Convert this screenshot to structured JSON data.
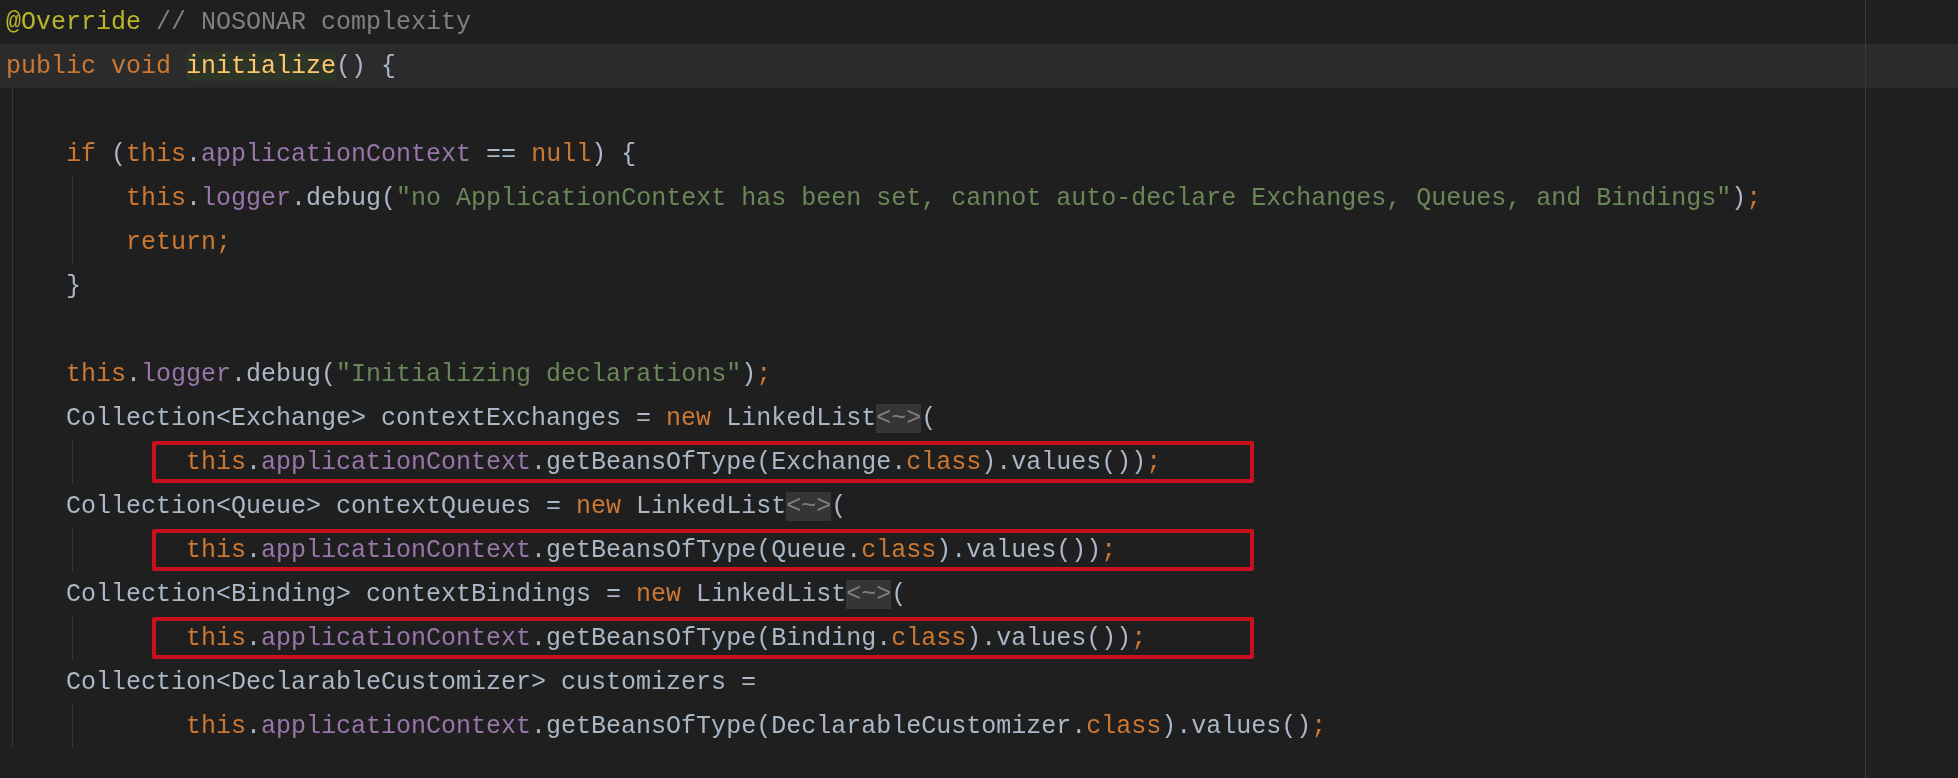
{
  "lines": [
    {
      "kind": "code",
      "current": false,
      "tokens": [
        {
          "kind": "annotation",
          "text": "@Override"
        },
        {
          "kind": "comment",
          "text": " // NOSONAR complexity"
        }
      ]
    },
    {
      "kind": "code",
      "current": true,
      "tokens": [
        {
          "kind": "keyword",
          "text": "public void "
        },
        {
          "kind": "declaration",
          "text": "initialize"
        },
        {
          "kind": "plain",
          "text": "() {"
        }
      ],
      "children": [
        {
          "kind": "blank",
          "current": false
        },
        {
          "kind": "code",
          "current": false,
          "tokens": [
            {
              "kind": "keyword",
              "text": "if"
            },
            {
              "kind": "plain",
              "text": " ("
            },
            {
              "kind": "keyword",
              "text": "this"
            },
            {
              "kind": "plain",
              "text": "."
            },
            {
              "kind": "field",
              "text": "applicationContext"
            },
            {
              "kind": "plain",
              "text": " == "
            },
            {
              "kind": "keyword",
              "text": "null"
            },
            {
              "kind": "plain",
              "text": ") {"
            }
          ],
          "children": [
            {
              "kind": "code",
              "current": false,
              "tokens": [
                {
                  "kind": "keyword",
                  "text": "this"
                },
                {
                  "kind": "plain",
                  "text": "."
                },
                {
                  "kind": "field",
                  "text": "logger"
                },
                {
                  "kind": "plain",
                  "text": ".debug("
                },
                {
                  "kind": "string",
                  "text": "\"no ApplicationContext has been set, cannot auto-declare Exchanges, Queues, and Bindings\""
                },
                {
                  "kind": "plain",
                  "text": ")"
                },
                {
                  "kind": "keyword",
                  "text": ";"
                }
              ]
            },
            {
              "kind": "code",
              "current": false,
              "tokens": [
                {
                  "kind": "keyword",
                  "text": "return;"
                }
              ]
            }
          ]
        },
        {
          "kind": "code",
          "current": false,
          "tokens": [
            {
              "kind": "plain",
              "text": "}"
            }
          ]
        },
        {
          "kind": "blank",
          "current": false
        },
        {
          "kind": "code",
          "current": false,
          "tokens": [
            {
              "kind": "keyword",
              "text": "this"
            },
            {
              "kind": "plain",
              "text": "."
            },
            {
              "kind": "field",
              "text": "logger"
            },
            {
              "kind": "plain",
              "text": ".debug("
            },
            {
              "kind": "string",
              "text": "\"Initializing declarations\""
            },
            {
              "kind": "plain",
              "text": ")"
            },
            {
              "kind": "keyword",
              "text": ";"
            }
          ]
        },
        {
          "kind": "code",
          "current": false,
          "tokens": [
            {
              "kind": "plain",
              "text": "Collection<Exchange> contextExchanges = "
            },
            {
              "kind": "keyword",
              "text": "new"
            },
            {
              "kind": "plain",
              "text": " LinkedList"
            },
            {
              "kind": "folded",
              "text": "<~>"
            },
            {
              "kind": "plain",
              "text": "("
            }
          ],
          "children": [
            {
              "kind": "continuation",
              "current": false,
              "boxed": true,
              "tokens": [
                {
                  "kind": "keyword",
                  "text": "this"
                },
                {
                  "kind": "plain",
                  "text": "."
                },
                {
                  "kind": "field",
                  "text": "applicationContext"
                },
                {
                  "kind": "plain",
                  "text": ".getBeansOfType(Exchange."
                },
                {
                  "kind": "keyword",
                  "text": "class"
                },
                {
                  "kind": "plain",
                  "text": ").values())"
                },
                {
                  "kind": "keyword",
                  "text": ";"
                }
              ]
            }
          ]
        },
        {
          "kind": "code",
          "current": false,
          "tokens": [
            {
              "kind": "plain",
              "text": "Collection<Queue> contextQueues = "
            },
            {
              "kind": "keyword",
              "text": "new"
            },
            {
              "kind": "plain",
              "text": " LinkedList"
            },
            {
              "kind": "folded",
              "text": "<~>"
            },
            {
              "kind": "plain",
              "text": "("
            }
          ],
          "children": [
            {
              "kind": "continuation",
              "current": false,
              "boxed": true,
              "tokens": [
                {
                  "kind": "keyword",
                  "text": "this"
                },
                {
                  "kind": "plain",
                  "text": "."
                },
                {
                  "kind": "field",
                  "text": "applicationContext"
                },
                {
                  "kind": "plain",
                  "text": ".getBeansOfType(Queue."
                },
                {
                  "kind": "keyword",
                  "text": "class"
                },
                {
                  "kind": "plain",
                  "text": ").values())"
                },
                {
                  "kind": "keyword",
                  "text": ";"
                }
              ]
            }
          ]
        },
        {
          "kind": "code",
          "current": false,
          "tokens": [
            {
              "kind": "plain",
              "text": "Collection<Binding> contextBindings = "
            },
            {
              "kind": "keyword",
              "text": "new"
            },
            {
              "kind": "plain",
              "text": " LinkedList"
            },
            {
              "kind": "folded",
              "text": "<~>"
            },
            {
              "kind": "plain",
              "text": "("
            }
          ],
          "children": [
            {
              "kind": "continuation",
              "current": false,
              "boxed": true,
              "tokens": [
                {
                  "kind": "keyword",
                  "text": "this"
                },
                {
                  "kind": "plain",
                  "text": "."
                },
                {
                  "kind": "field",
                  "text": "applicationContext"
                },
                {
                  "kind": "plain",
                  "text": ".getBeansOfType(Binding."
                },
                {
                  "kind": "keyword",
                  "text": "class"
                },
                {
                  "kind": "plain",
                  "text": ").values())"
                },
                {
                  "kind": "keyword",
                  "text": ";"
                }
              ]
            }
          ]
        },
        {
          "kind": "code",
          "current": false,
          "tokens": [
            {
              "kind": "plain",
              "text": "Collection<DeclarableCustomizer> customizers ="
            }
          ],
          "children": [
            {
              "kind": "continuation",
              "current": false,
              "boxed": false,
              "tokens": [
                {
                  "kind": "keyword",
                  "text": "this"
                },
                {
                  "kind": "plain",
                  "text": "."
                },
                {
                  "kind": "field",
                  "text": "applicationContext"
                },
                {
                  "kind": "plain",
                  "text": ".getBeansOfType(DeclarableCustomizer."
                },
                {
                  "kind": "keyword",
                  "text": "class"
                },
                {
                  "kind": "plain",
                  "text": ").values()"
                },
                {
                  "kind": "keyword",
                  "text": ";"
                }
              ]
            }
          ]
        }
      ]
    }
  ]
}
